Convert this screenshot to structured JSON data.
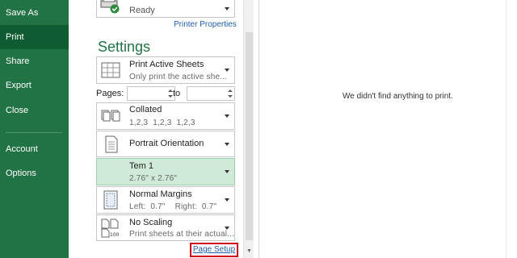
{
  "nav": {
    "items": [
      {
        "label": "Save As",
        "active": false
      },
      {
        "label": "Print",
        "active": true
      },
      {
        "label": "Share",
        "active": false
      },
      {
        "label": "Export",
        "active": false
      },
      {
        "label": "Close",
        "active": false
      },
      {
        "label": "Account",
        "active": false
      },
      {
        "label": "Options",
        "active": false
      }
    ]
  },
  "printer": {
    "status": "Ready",
    "properties_link": "Printer Properties"
  },
  "settings": {
    "title": "Settings",
    "print_what": {
      "main": "Print Active Sheets",
      "sub": "Only print the active she..."
    },
    "pages": {
      "label": "Pages:",
      "from_value": "",
      "to_label": "to",
      "to_value": ""
    },
    "collation": {
      "main": "Collated",
      "sub": "1,2,3    1,2,3    1,2,3"
    },
    "orientation": {
      "main": "Portrait Orientation"
    },
    "paper": {
      "main": "Tem 1",
      "sub": "2.76\" x 2.76\""
    },
    "margins": {
      "main": "Normal Margins",
      "sub": "Left:  0.7\"    Right:  0.7\""
    },
    "scaling": {
      "main": "No Scaling",
      "sub": "Print sheets at their actual..."
    },
    "page_setup_link": "Page Setup"
  },
  "preview": {
    "message": "We didn't find anything to print."
  },
  "colors": {
    "nav_bg": "#217346",
    "nav_active": "#0f5c33",
    "accent": "#217346",
    "link": "#1f5da8",
    "selected_bg": "#cfead8",
    "highlight_border": "#d0021b"
  }
}
